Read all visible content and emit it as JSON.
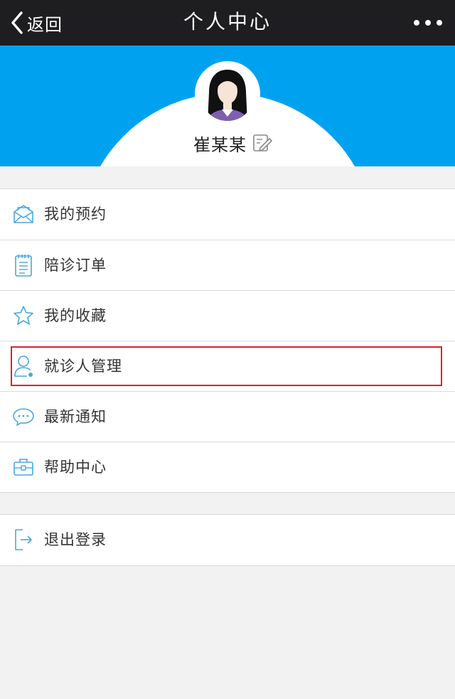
{
  "navbar": {
    "back_label": "返回",
    "title": "个人中心",
    "more_icon": "more-dots-icon"
  },
  "profile": {
    "name": "崔某某",
    "edit_icon": "edit-icon",
    "header_color": "#00a2f0"
  },
  "menu": {
    "items": [
      {
        "label": "我的预约",
        "icon": "envelope-icon"
      },
      {
        "label": "陪诊订单",
        "icon": "clipboard-icon"
      },
      {
        "label": "我的收藏",
        "icon": "star-icon"
      },
      {
        "label": "就诊人管理",
        "icon": "user-icon",
        "highlighted": true
      },
      {
        "label": "最新通知",
        "icon": "chat-bubble-icon"
      },
      {
        "label": "帮助中心",
        "icon": "briefcase-icon"
      }
    ],
    "logout": {
      "label": "退出登录",
      "icon": "exit-icon"
    }
  },
  "colors": {
    "navbar": "#1e1e20",
    "accent": "#00a2f0",
    "icon": "#4aa8dc",
    "highlight": "#d2262d"
  }
}
